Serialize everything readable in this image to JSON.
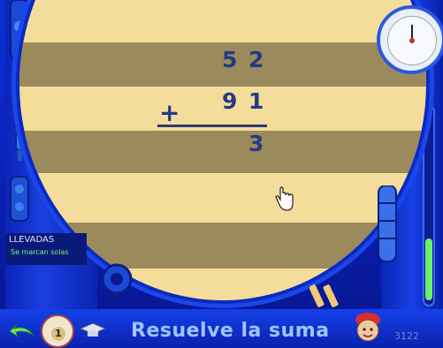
{
  "sum": {
    "row1": [
      "5",
      "2"
    ],
    "row2": [
      "9",
      "1"
    ],
    "operator": "+",
    "answer": [
      "3"
    ]
  },
  "llevadas": {
    "title": "LLEVADAS",
    "option": "Se marcan solas"
  },
  "bottom_bar": {
    "title": "Resuelve la suma",
    "level_badge": "1",
    "score": "3122"
  },
  "icons": {
    "back": "back-arrow-icon",
    "level": "level-badge-icon",
    "cap": "graduation-cap-icon",
    "pointer": "hand-cursor-icon",
    "clock": "clock-icon",
    "character": "character-icon"
  },
  "colors": {
    "frame": "#0d2fd8",
    "paper": "#f4dc9a",
    "band": "#9a8a5c",
    "digits": "#243a84",
    "title": "#9fc4ff"
  }
}
